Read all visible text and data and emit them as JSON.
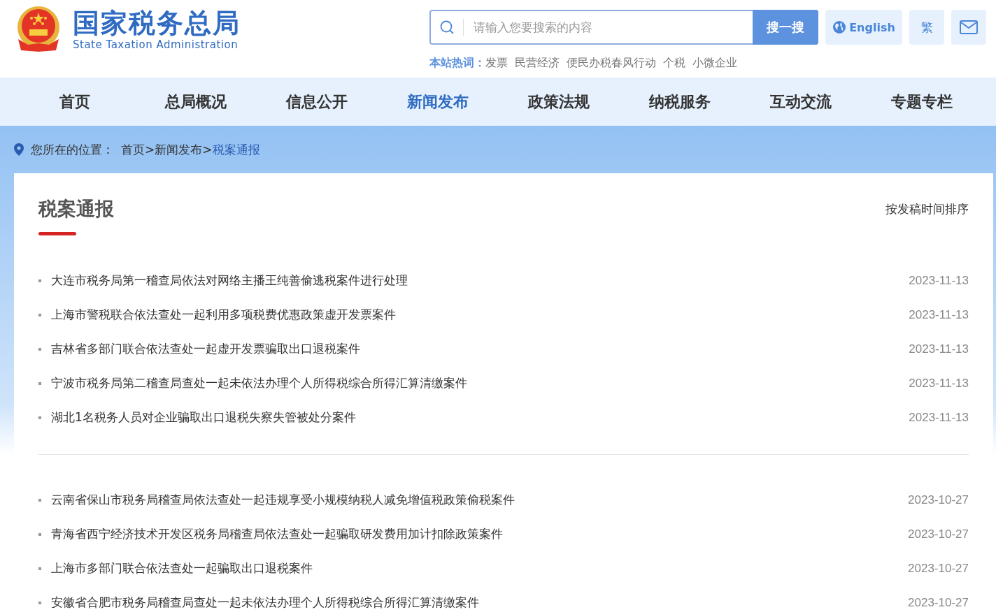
{
  "header": {
    "site_name": "国家税务总局",
    "site_name_en": "State Taxation Administration",
    "search": {
      "placeholder": "请输入您要搜索的内容",
      "button": "搜一搜"
    },
    "english_button": "English",
    "traditional_button": "繁",
    "hot_words": {
      "label": "本站热词：",
      "words": [
        "发票",
        "民营经济",
        "便民办税春风行动",
        "个税",
        "小微企业"
      ]
    }
  },
  "nav": [
    {
      "label": "首页",
      "selected": false
    },
    {
      "label": "总局概况",
      "selected": false
    },
    {
      "label": "信息公开",
      "selected": false
    },
    {
      "label": "新闻发布",
      "selected": true
    },
    {
      "label": "政策法规",
      "selected": false
    },
    {
      "label": "纳税服务",
      "selected": false
    },
    {
      "label": "互动交流",
      "selected": false
    },
    {
      "label": "专题专栏",
      "selected": false
    }
  ],
  "breadcrumb": {
    "label": "您所在的位置：",
    "separator": ">",
    "items": [
      {
        "label": "首页",
        "selected": false
      },
      {
        "label": "新闻发布",
        "selected": false
      },
      {
        "label": "税案通报",
        "selected": true
      }
    ]
  },
  "section": {
    "title": "税案通报",
    "sort": "按发稿时间排序",
    "groups": [
      [
        {
          "title": "大连市税务局第一稽查局依法对网络主播王纯善偷逃税案件进行处理",
          "date": "2023-11-13"
        },
        {
          "title": "上海市警税联合依法查处一起利用多项税费优惠政策虚开发票案件",
          "date": "2023-11-13"
        },
        {
          "title": "吉林省多部门联合依法查处一起虚开发票骗取出口退税案件",
          "date": "2023-11-13"
        },
        {
          "title": "宁波市税务局第二稽查局查处一起未依法办理个人所得税综合所得汇算清缴案件",
          "date": "2023-11-13"
        },
        {
          "title": "湖北1名税务人员对企业骗取出口退税失察失管被处分案件",
          "date": "2023-11-13"
        }
      ],
      [
        {
          "title": "云南省保山市税务局稽查局依法查处一起违规享受小规模纳税人减免增值税政策偷税案件",
          "date": "2023-10-27"
        },
        {
          "title": "青海省西宁经济技术开发区税务局稽查局依法查处一起骗取研发费用加计扣除政策案件",
          "date": "2023-10-27"
        },
        {
          "title": "上海市多部门联合依法查处一起骗取出口退税案件",
          "date": "2023-10-27"
        },
        {
          "title": "安徽省合肥市税务局稽查局查处一起未依法办理个人所得税综合所得汇算清缴案件",
          "date": "2023-10-27"
        }
      ]
    ]
  }
}
